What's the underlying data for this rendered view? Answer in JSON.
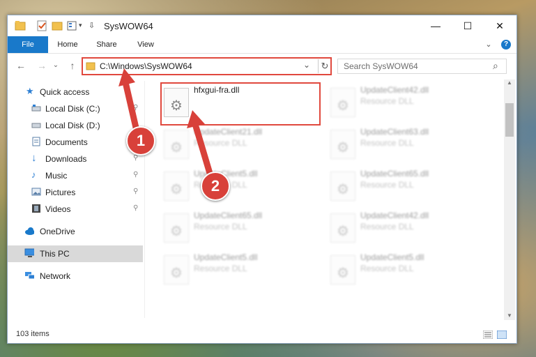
{
  "window": {
    "title": "SysWOW64",
    "minimize": "—",
    "maximize": "☐",
    "close": "✕"
  },
  "ribbon": {
    "tabs": [
      "File",
      "Home",
      "Share",
      "View"
    ],
    "expand": "⌄",
    "help": "?"
  },
  "nav": {
    "back": "←",
    "forward": "→",
    "recent": "⌄",
    "up": "↑",
    "address": "C:\\Windows\\SysWOW64",
    "address_dropdown": "⌄",
    "refresh": "↻",
    "search_placeholder": "Search SysWOW64",
    "search_icon": "⌕"
  },
  "sidebar": {
    "items": [
      {
        "label": "Quick access",
        "icon": "star-icon"
      },
      {
        "label": "Local Disk (C:)",
        "icon": "drive-icon"
      },
      {
        "label": "Local Disk (D:)",
        "icon": "drive-icon"
      },
      {
        "label": "Documents",
        "icon": "documents-icon"
      },
      {
        "label": "Downloads",
        "icon": "download-icon"
      },
      {
        "label": "Music",
        "icon": "music-icon"
      },
      {
        "label": "Pictures",
        "icon": "pictures-icon"
      },
      {
        "label": "Videos",
        "icon": "videos-icon"
      },
      {
        "label": "OneDrive",
        "icon": "cloud-icon"
      },
      {
        "label": "This PC",
        "icon": "computer-icon"
      },
      {
        "label": "Network",
        "icon": "network-icon"
      }
    ],
    "pin": "📌"
  },
  "files": [
    {
      "name": "hfxgui-fra.dll",
      "type": ""
    },
    {
      "name": "UpdateClient42.dll",
      "type": "Resource DLL"
    },
    {
      "name": "UpdateClient21.dll",
      "type": "Resource DLL"
    },
    {
      "name": "UpdateClient63.dll",
      "type": "Resource DLL"
    },
    {
      "name": "UpdateClient5.dll",
      "type": "Resource DLL"
    },
    {
      "name": "UpdateClient65.dll",
      "type": "Resource DLL"
    },
    {
      "name": "UpdateClient65.dll",
      "type": "Resource DLL"
    },
    {
      "name": "UpdateClient42.dll",
      "type": "Resource DLL"
    },
    {
      "name": "UpdateClient5.dll",
      "type": "Resource DLL"
    },
    {
      "name": "UpdateClient5.dll",
      "type": "Resource DLL"
    }
  ],
  "status": {
    "item_count": "103 items"
  },
  "annotations": {
    "step1": "1",
    "step2": "2",
    "color": "#d8413a"
  }
}
